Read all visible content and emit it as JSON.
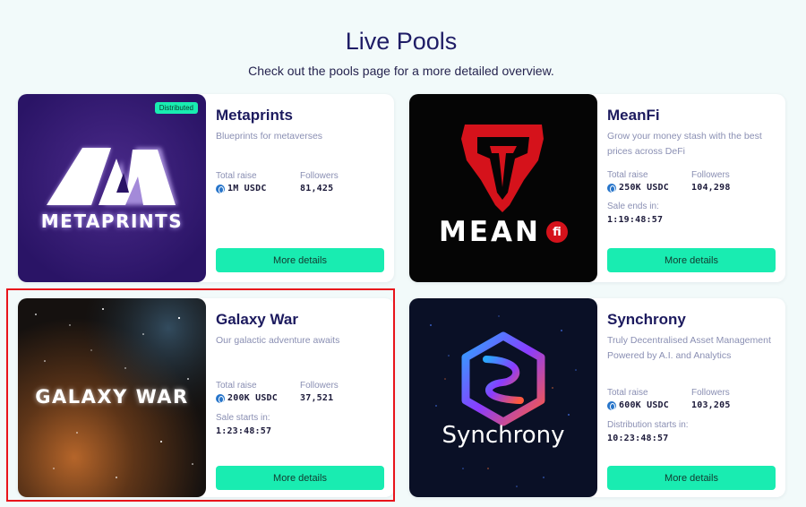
{
  "header": {
    "title": "Live Pools",
    "subtitle": "Check out the pools page for a more detailed overview."
  },
  "colors": {
    "accent": "#19ecb1",
    "title": "#1c1a5e",
    "highlight": "#e8141b"
  },
  "pools": [
    {
      "name": "Metaprints",
      "description": "Blueprints for metaverses",
      "badge": "Distributed",
      "logo_text": "METAPRINTS",
      "total_raise_label": "Total raise",
      "total_raise": "1M USDC",
      "followers_label": "Followers",
      "followers": "81,425",
      "button": "More details"
    },
    {
      "name": "MeanFi",
      "description": "Grow your money stash with the best prices across DeFi",
      "logo_text": "MEAN",
      "logo_badge": "fi",
      "total_raise_label": "Total raise",
      "total_raise": "250K USDC",
      "followers_label": "Followers",
      "followers": "104,298",
      "timer_label": "Sale ends in:",
      "timer": "1:19:48:57",
      "button": "More details"
    },
    {
      "name": "Galaxy War",
      "description": "Our galactic adventure awaits",
      "logo_text": "GALAXY WAR",
      "total_raise_label": "Total raise",
      "total_raise": "200K USDC",
      "followers_label": "Followers",
      "followers": "37,521",
      "timer_label": "Sale starts in:",
      "timer": "1:23:48:57",
      "button": "More details"
    },
    {
      "name": "Synchrony",
      "description": "Truly Decentralised Asset Management Powered by A.I. and Analytics",
      "logo_text": "Synchrony",
      "total_raise_label": "Total raise",
      "total_raise": "600K USDC",
      "followers_label": "Followers",
      "followers": "103,205",
      "timer_label": "Distribution starts in:",
      "timer": "10:23:48:57",
      "button": "More details"
    }
  ]
}
